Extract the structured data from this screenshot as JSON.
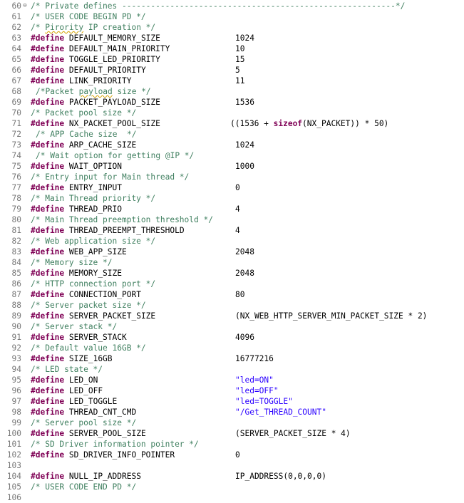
{
  "editor": {
    "lines": [
      {
        "n": "60",
        "fold": "⊖",
        "indent": 0,
        "comment_parts": [
          "/* Private defines ---------------------------------------------------------*/"
        ]
      },
      {
        "n": "61",
        "indent": 0,
        "comment_parts": [
          "/* USER CODE BEGIN PD */"
        ]
      },
      {
        "n": "62",
        "indent": 0,
        "comment_parts": [
          "/* ",
          "Pirority",
          " IP creation */"
        ],
        "squig": 1
      },
      {
        "n": "63",
        "kw": "#define",
        "name": "DEFAULT_MEMORY_SIZE",
        "value": "1024"
      },
      {
        "n": "64",
        "kw": "#define",
        "name": "DEFAULT_MAIN_PRIORITY",
        "value": "10"
      },
      {
        "n": "65",
        "kw": "#define",
        "name": "TOGGLE_LED_PRIORITY",
        "value": "15"
      },
      {
        "n": "66",
        "kw": "#define",
        "name": "DEFAULT_PRIORITY",
        "value": "5"
      },
      {
        "n": "67",
        "kw": "#define",
        "name": "LINK_PRIORITY",
        "value": "11"
      },
      {
        "n": "68",
        "indent": 1,
        "comment_parts": [
          "/*Packet ",
          "payload",
          " size */"
        ],
        "squig": 1
      },
      {
        "n": "69",
        "kw": "#define",
        "name": "PACKET_PAYLOAD_SIZE",
        "value": "1536"
      },
      {
        "n": "70",
        "indent": 0,
        "comment_parts": [
          "/* Packet pool size */"
        ]
      },
      {
        "n": "71",
        "kw": "#define",
        "name": "NX_PACKET_POOL_SIZE",
        "value_pre": "((1536 + ",
        "value_kw": "sizeof",
        "value_post": "(NX_PACKET)) * 50)",
        "vshift": -1
      },
      {
        "n": "72",
        "indent": 1,
        "comment_parts": [
          "/* APP Cache size  */"
        ]
      },
      {
        "n": "73",
        "kw": "#define",
        "name": "ARP_CACHE_SIZE",
        "value": "1024"
      },
      {
        "n": "74",
        "indent": 1,
        "comment_parts": [
          "/* Wait option for getting @IP */"
        ]
      },
      {
        "n": "75",
        "kw": "#define",
        "name": "WAIT_OPTION",
        "value": "1000"
      },
      {
        "n": "76",
        "indent": 0,
        "comment_parts": [
          "/* Entry input for Main thread */"
        ]
      },
      {
        "n": "77",
        "kw": "#define",
        "name": "ENTRY_INPUT",
        "value": "0"
      },
      {
        "n": "78",
        "indent": 0,
        "comment_parts": [
          "/* Main Thread priority */"
        ]
      },
      {
        "n": "79",
        "kw": "#define",
        "name": "THREAD_PRIO",
        "value": "4"
      },
      {
        "n": "80",
        "indent": 0,
        "comment_parts": [
          "/* Main Thread preemption threshold */"
        ]
      },
      {
        "n": "81",
        "kw": "#define",
        "name": "THREAD_PREEMPT_THRESHOLD",
        "value": "4"
      },
      {
        "n": "82",
        "indent": 0,
        "comment_parts": [
          "/* Web application size */"
        ]
      },
      {
        "n": "83",
        "kw": "#define",
        "name": "WEB_APP_SIZE",
        "value": "2048"
      },
      {
        "n": "84",
        "indent": 0,
        "comment_parts": [
          "/* Memory size */"
        ]
      },
      {
        "n": "85",
        "kw": "#define",
        "name": "MEMORY_SIZE",
        "value": "2048"
      },
      {
        "n": "86",
        "indent": 0,
        "comment_parts": [
          "/* HTTP connection port */"
        ]
      },
      {
        "n": "87",
        "kw": "#define",
        "name": "CONNECTION_PORT",
        "value": "80"
      },
      {
        "n": "88",
        "indent": 0,
        "comment_parts": [
          "/* Server packet size */"
        ]
      },
      {
        "n": "89",
        "kw": "#define",
        "name": "SERVER_PACKET_SIZE",
        "value": "(NX_WEB_HTTP_SERVER_MIN_PACKET_SIZE * 2)"
      },
      {
        "n": "90",
        "indent": 0,
        "comment_parts": [
          "/* Server stack */"
        ]
      },
      {
        "n": "91",
        "kw": "#define",
        "name": "SERVER_STACK",
        "value": "4096"
      },
      {
        "n": "92",
        "indent": 0,
        "comment_parts": [
          "/* Default value 16GB */"
        ]
      },
      {
        "n": "93",
        "kw": "#define",
        "name": "SIZE_16GB",
        "value": "16777216"
      },
      {
        "n": "94",
        "indent": 0,
        "comment_parts": [
          "/* LED state */"
        ]
      },
      {
        "n": "95",
        "kw": "#define",
        "name": "LED_ON",
        "value": "\"led=ON\"",
        "str": true
      },
      {
        "n": "96",
        "kw": "#define",
        "name": "LED_OFF",
        "value": "\"led=OFF\"",
        "str": true
      },
      {
        "n": "97",
        "kw": "#define",
        "name": "LED_TOGGLE",
        "value": "\"led=TOGGLE\"",
        "str": true
      },
      {
        "n": "98",
        "kw": "#define",
        "name": "THREAD_CNT_CMD",
        "value": "\"/Get_THREAD_COUNT\"",
        "str": true
      },
      {
        "n": "99",
        "indent": 0,
        "comment_parts": [
          "/* Server pool size */"
        ]
      },
      {
        "n": "100",
        "kw": "#define",
        "name": "SERVER_POOL_SIZE",
        "value": "(SERVER_PACKET_SIZE * 4)"
      },
      {
        "n": "101",
        "indent": 0,
        "comment_parts": [
          "/* SD Driver information pointer */"
        ]
      },
      {
        "n": "102",
        "kw": "#define",
        "name": "SD_DRIVER_INFO_POINTER",
        "value": "0"
      },
      {
        "n": "103"
      },
      {
        "n": "104",
        "kw": "#define",
        "name": "NULL_IP_ADDRESS",
        "value": "IP_ADDRESS(0,0,0,0)"
      },
      {
        "n": "105",
        "indent": 0,
        "comment_parts": [
          "/* USER CODE END PD */"
        ]
      },
      {
        "n": "106"
      }
    ]
  }
}
